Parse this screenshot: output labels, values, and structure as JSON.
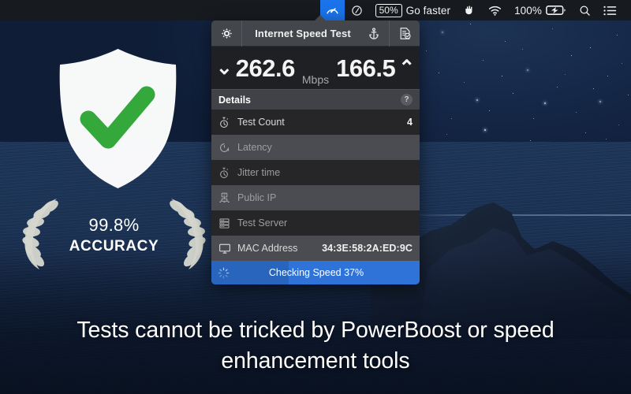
{
  "menubar": {
    "items": [
      {
        "name": "speedtest-menu-icon",
        "icon": "speedometer-icon",
        "label": "",
        "active": true
      },
      {
        "name": "link-menu-icon",
        "icon": "link-icon",
        "label": "",
        "active": false
      },
      {
        "name": "go-faster-item",
        "icon": "percent-badge",
        "label": "Go faster",
        "badge": "50%",
        "active": false
      },
      {
        "name": "hand-menu-icon",
        "icon": "hand-icon",
        "label": "",
        "active": false
      },
      {
        "name": "wifi-menu-icon",
        "icon": "wifi-icon",
        "label": "",
        "active": false
      },
      {
        "name": "battery-menu-item",
        "icon": "battery-charging-icon",
        "label": "100%",
        "active": false
      },
      {
        "name": "spotlight-menu-icon",
        "icon": "search-icon",
        "label": "",
        "active": false
      },
      {
        "name": "control-center-menu-icon",
        "icon": "list-icon",
        "label": "",
        "active": false
      }
    ]
  },
  "popover": {
    "title": "Internet Speed Test",
    "header_buttons": [
      {
        "name": "settings-button",
        "icon": "gear-icon"
      },
      {
        "name": "anchor-button",
        "icon": "anchor-icon"
      },
      {
        "name": "report-button",
        "icon": "document-check-icon"
      }
    ],
    "speeds": {
      "download_value": "262.6",
      "download_icon": "double-chevron-down-icon",
      "unit": "Mbps",
      "upload_value": "166.5",
      "upload_icon": "double-chevron-up-icon"
    },
    "details": {
      "header": "Details",
      "help_glyph": "?",
      "rows": [
        {
          "name": "row-test-count",
          "icon": "stopwatch-icon",
          "label": "Test Count",
          "value": "4",
          "dim": false
        },
        {
          "name": "row-latency",
          "icon": "latency-icon",
          "label": "Latency",
          "value": "",
          "dim": true
        },
        {
          "name": "row-jitter-time",
          "icon": "stopwatch-icon",
          "label": "Jitter time",
          "value": "",
          "dim": true
        },
        {
          "name": "row-public-ip",
          "icon": "ip-network-icon",
          "label": "Public IP",
          "value": "",
          "dim": true
        },
        {
          "name": "row-test-server",
          "icon": "server-icon",
          "label": "Test Server",
          "value": "",
          "dim": true
        },
        {
          "name": "row-mac-address",
          "icon": "monitor-icon",
          "label": "MAC Address",
          "value": "34:3E:58:2A:ED:9C",
          "dim": false
        }
      ]
    },
    "progress": {
      "label": "Checking Speed 37%",
      "percent": 37,
      "spinner_icon": "spinner-icon",
      "fill_color": "#2a65bd",
      "track_color": "#2f73d8"
    }
  },
  "badge": {
    "shield_icon": "shield-check-icon",
    "check_color": "#34a83a",
    "accuracy_percent": "99.8%",
    "accuracy_label": "ACCURACY",
    "laurel_icon": "laurel-wreath-icon"
  },
  "caption": "Tests cannot be tricked by PowerBoost or speed enhancement tools"
}
